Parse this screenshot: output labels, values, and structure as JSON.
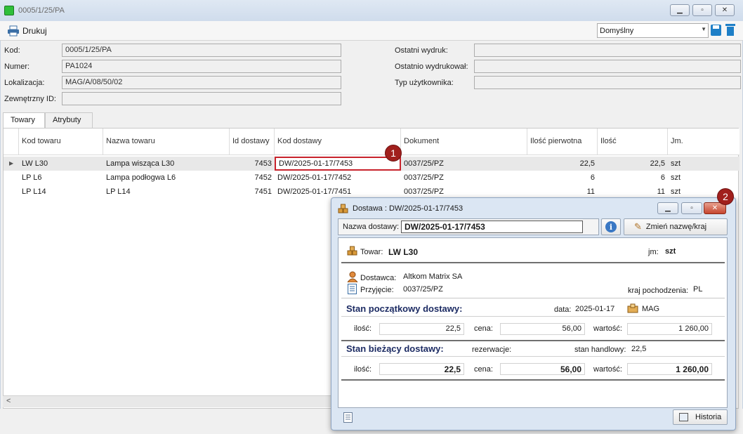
{
  "window": {
    "title": "0005/1/25/PA"
  },
  "toolbar": {
    "print_label": "Drukuj",
    "layout_value": "Domyślny"
  },
  "form": {
    "kod_label": "Kod:",
    "kod_value": "0005/1/25/PA",
    "numer_label": "Numer:",
    "numer_value": "PA1024",
    "lokalizacja_label": "Lokalizacja:",
    "lokalizacja_value": "MAG/A/08/50/02",
    "zewnetrzny_label": "Zewnętrzny ID:",
    "zewnetrzny_value": "",
    "ostatni_wydruk_label": "Ostatni wydruk:",
    "ostatni_wydruk_value": "",
    "ostatnio_wydrukowal_label": "Ostatnio wydrukował:",
    "ostatnio_wydrukowal_value": "",
    "typ_uzytkownika_label": "Typ użytkownika:",
    "typ_uzytkownika_value": ""
  },
  "tabs": [
    "Towary",
    "Atrybuty"
  ],
  "grid": {
    "columns": [
      "Kod towaru",
      "Nazwa towaru",
      "Id dostawy",
      "Kod dostawy",
      "Dokument",
      "Ilość pierwotna",
      "Ilość",
      "Jm."
    ],
    "rows": [
      [
        "LW L30",
        "Lampa wisząca L30",
        "7453",
        "DW/2025-01-17/7453",
        "0037/25/PZ",
        "22,5",
        "22,5",
        "szt"
      ],
      [
        "LP L6",
        "Lampa podłogwa L6",
        "7452",
        "DW/2025-01-17/7452",
        "0037/25/PZ",
        "6",
        "6",
        "szt"
      ],
      [
        "LP L14",
        "LP L14",
        "7451",
        "DW/2025-01-17/7451",
        "0037/25/PZ",
        "11",
        "11",
        "szt"
      ]
    ]
  },
  "callouts": [
    "1",
    "2"
  ],
  "dialog": {
    "title": "Dostawa : DW/2025-01-17/7453",
    "nazwa_label": "Nazwa dostawy:",
    "nazwa_value": "DW/2025-01-17/7453",
    "rename_label": "Zmień nazwę/kraj",
    "towar_label": "Towar:",
    "towar_value": "LW L30",
    "jm_label": "jm:",
    "jm_value": "szt",
    "dostawca_label": "Dostawca:",
    "dostawca_value": "Altkom Matrix SA",
    "przyjecie_label": "Przyjęcie:",
    "przyjecie_value": "0037/25/PZ",
    "kraj_label": "kraj pochodzenia:",
    "kraj_value": "PL",
    "stan_pocz_heading": "Stan początkowy dostawy:",
    "data_label": "data:",
    "data_value": "2025-01-17",
    "mag_value": "MAG",
    "ilosc_label": "ilość:",
    "cena_label": "cena:",
    "wartosc_label": "wartość:",
    "pocz_ilosc": "22,5",
    "pocz_cena": "56,00",
    "pocz_wartosc": "1 260,00",
    "stan_biez_heading": "Stan bieżący dostawy:",
    "rezerwacje_label": "rezerwacje:",
    "stan_handlowy_label": "stan handlowy:",
    "stan_handlowy_value": "22,5",
    "biez_ilosc": "22,5",
    "biez_cena": "56,00",
    "biez_wartosc": "1 260,00",
    "historia_label": "Historia"
  },
  "colors": {
    "accent_red": "#a1201d",
    "heading_navy": "#1c2b63",
    "selected_row": "#e8e8e8"
  }
}
